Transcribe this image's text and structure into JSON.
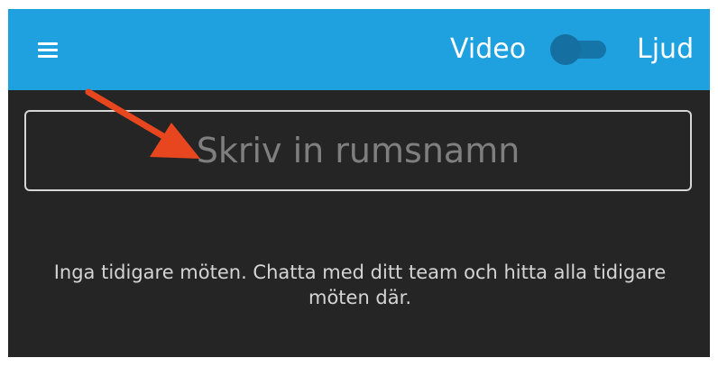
{
  "header": {
    "menu_icon": "hamburger-menu-icon",
    "video_label": "Video",
    "toggle_state": "off",
    "audio_label": "Ljud",
    "accent_color": "#1fa1e0"
  },
  "room": {
    "placeholder": "Skriv in rumsnamn",
    "value": ""
  },
  "annotation": {
    "icon": "red-arrow-icon",
    "color": "#e8461e"
  },
  "empty_state": {
    "message": "Inga tidigare möten. Chatta med ditt team och hitta alla tidigare möten där."
  }
}
